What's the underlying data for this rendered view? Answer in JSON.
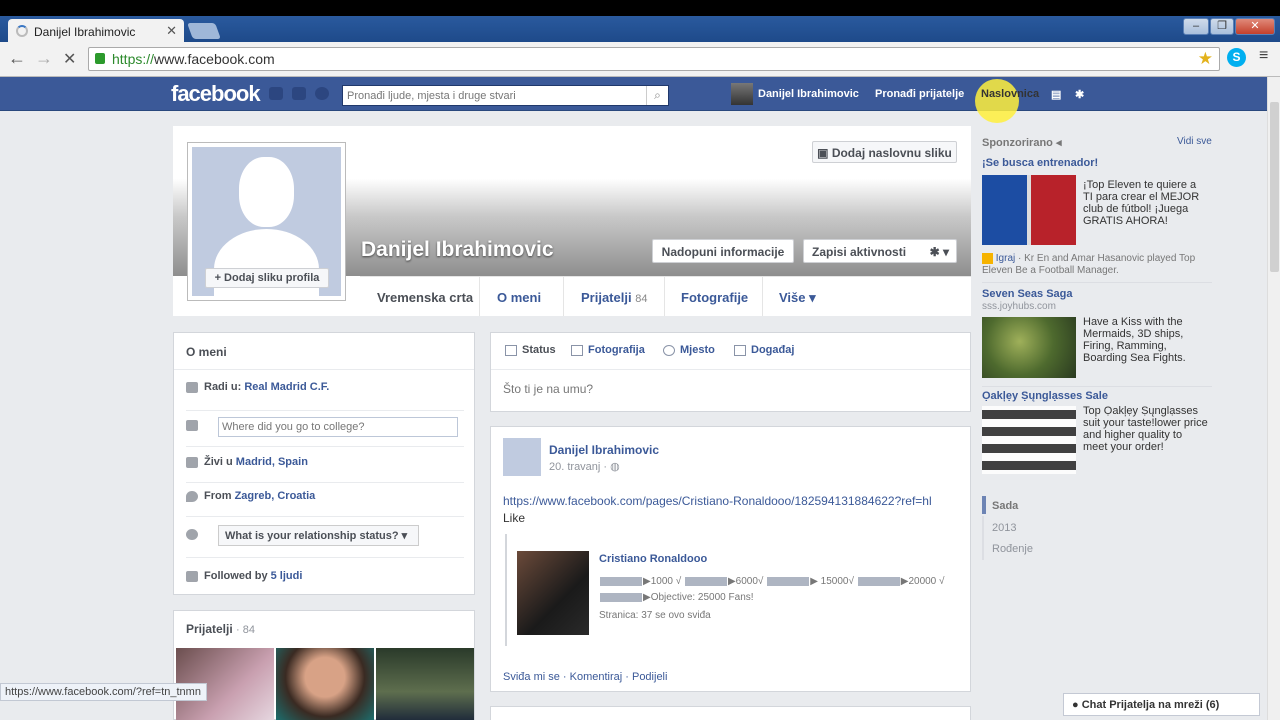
{
  "browser": {
    "tab_title": "Danijel Ibrahimovic",
    "url_https": "https://",
    "url_rest": "www.facebook.com",
    "status_url": "https://www.facebook.com/?ref=tn_tnmn"
  },
  "fbbar": {
    "logo": "facebook",
    "search_placeholder": "Pronađi ljude, mjesta i druge stvari",
    "user_name": "Danijel Ibrahimovic",
    "find_friends": "Pronađi prijatelje",
    "home": "Naslovnica"
  },
  "profile": {
    "name": "Danijel Ibrahimovic",
    "add_cover": "Dodaj naslovnu sliku",
    "add_photo": "+ Dodaj sliku profila",
    "update_info": "Nadopuni informacije",
    "activity_log": "Zapisi aktivnosti",
    "tabs": [
      {
        "label": "Vremenska crta",
        "count": ""
      },
      {
        "label": "O meni",
        "count": ""
      },
      {
        "label": "Prijatelji",
        "count": "84"
      },
      {
        "label": "Fotografije",
        "count": ""
      },
      {
        "label": "Više ▾",
        "count": ""
      }
    ]
  },
  "about": {
    "title": "O meni",
    "work_prefix": "Radi u:",
    "work": "Real Madrid C.F.",
    "college_placeholder": "Where did you go to college?",
    "lives_prefix": "Živi u",
    "lives": "Madrid, Spain",
    "from_prefix": "From",
    "from": "Zagreb, Croatia",
    "relationship": "What is your relationship status?",
    "followed_prefix": "Followed by",
    "followed": "5 ljudi"
  },
  "friends": {
    "title": "Prijatelji",
    "count": "· 84"
  },
  "composer": {
    "tabs": [
      "Status",
      "Fotografija",
      "Mjesto",
      "Događaj"
    ],
    "placeholder": "Što ti je na umu?"
  },
  "post": {
    "author": "Danijel Ibrahimovic",
    "date": "20. travanj",
    "text_line1": "https://www.facebook.com/pages/Cristiano-Ronaldooo/182594131884622?ref=hl",
    "text_line2": "Like",
    "attach_title": "Cristiano Ronaldooo",
    "attach_line1_a": "▶1000 √",
    "attach_line1_b": "▶6000√",
    "attach_line1_c": "▶ 15000√",
    "attach_line1_d": "▶20000",
    "attach_line2": "▶Objective: 25000 Fans!",
    "attach_line3": "Stranica: 37 se ovo sviđa",
    "actions": "Sviđa mi se · Komentiraj · Podijeli"
  },
  "sidebar": {
    "sponsored": "Sponzorirano",
    "see_all": "Vidi sve",
    "ads": [
      {
        "title": "¡Se busca entrenador!",
        "text": "¡Top Eleven te quiere a TI para crear el MEJOR club de fútbol! ¡Juega GRATIS AHORA!"
      },
      {
        "title": "Seven Seas Saga",
        "domain": "sss.joyhubs.com",
        "text": "Have a Kiss with the Mermaids, 3D ships, Firing, Ramming, Boarding Sea Fights."
      },
      {
        "title": "Ọakļẹy Ṣųnglạsses Sale",
        "text": "Top Ọakļẹy Ṣųnglạsses suit your taste!lower price and higher quality to meet your order!"
      }
    ],
    "social_play": "Igraj",
    "social_text": " · Kr En and Amar Hasanovic played Top Eleven Be a Football Manager.",
    "timeline": [
      "Sada",
      "2013",
      "Rođenje"
    ]
  },
  "chat": {
    "label": "Chat Prijatelja na mreži (6)"
  }
}
